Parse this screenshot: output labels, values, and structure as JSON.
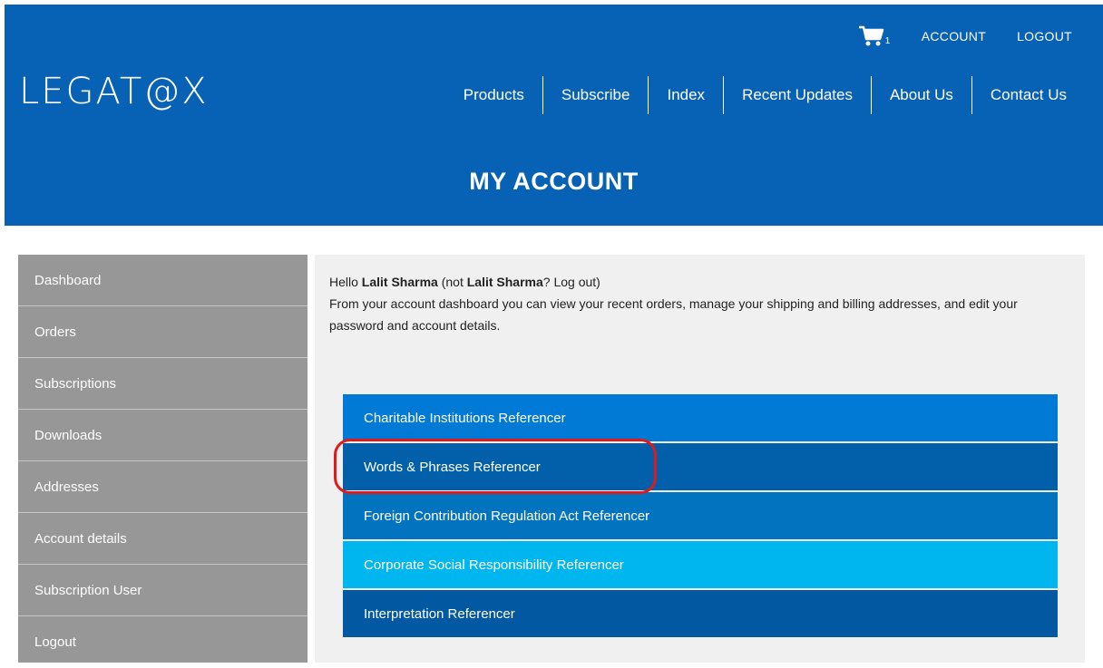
{
  "brand": {
    "logo_text": "LEGAT@X",
    "header_color": "#0762b5"
  },
  "top_links": {
    "cart_count": "1",
    "account": "ACCOUNT",
    "logout": "LOGOUT"
  },
  "nav": [
    "Products",
    "Subscribe",
    "Index",
    "Recent Updates",
    "About Us",
    "Contact Us"
  ],
  "page_title": "MY ACCOUNT",
  "sidebar": {
    "items": [
      {
        "label": "Dashboard"
      },
      {
        "label": "Orders"
      },
      {
        "label": "Subscriptions"
      },
      {
        "label": "Downloads"
      },
      {
        "label": "Addresses"
      },
      {
        "label": "Account details"
      },
      {
        "label": "Subscription User"
      },
      {
        "label": "Logout"
      }
    ]
  },
  "greeting": {
    "hello": "Hello ",
    "user_name": "Lalit Sharma",
    "not_prefix": " (not ",
    "not_name": "Lalit Sharma",
    "logout_suffix": "? Log out)",
    "description": "From your account dashboard you can view your recent orders, manage your shipping and billing addresses, and edit your password and account details."
  },
  "referencers": [
    {
      "label": "Charitable Institutions Referencer",
      "color": "#007ad4"
    },
    {
      "label": "Words & Phrases Referencer",
      "color": "#0160a9"
    },
    {
      "label": "Foreign Contribution Regulation Act Referencer",
      "color": "#0274bf"
    },
    {
      "label": "Corporate Social Responsibility Referencer",
      "color": "#00b6ee"
    },
    {
      "label": "Interpretation Referencer",
      "color": "#0359a1"
    }
  ],
  "annotation": {
    "highlight_color": "#e01a1a"
  }
}
